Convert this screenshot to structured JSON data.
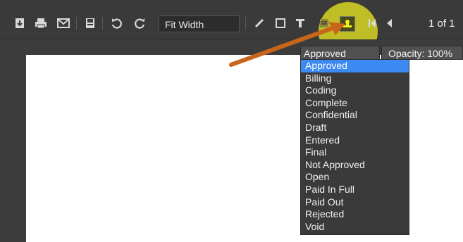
{
  "toolbar": {
    "zoom_value": "Fit Width",
    "page_count": "1 of 1",
    "icons": [
      "download-icon",
      "print-icon",
      "email-icon",
      "save-icon",
      "undo-icon",
      "redo-icon",
      "pen-icon",
      "rectangle-icon",
      "text-icon",
      "note-icon",
      "stamp-icon",
      "first-page-icon",
      "previous-page-icon"
    ]
  },
  "stamp": {
    "selected": "Approved",
    "opacity_label": "Opacity: 100%",
    "options": [
      "Approved",
      "Billing",
      "Coding",
      "Complete",
      "Confidential",
      "Draft",
      "Entered",
      "Final",
      "Not Approved",
      "Open",
      "Paid In Full",
      "Paid Out",
      "Rejected",
      "Void"
    ]
  },
  "colors": {
    "toolbar_bg": "#3a3a3a",
    "highlight": "#f4f11f",
    "selection": "#3d8af2",
    "arrow": "#d2691e"
  }
}
